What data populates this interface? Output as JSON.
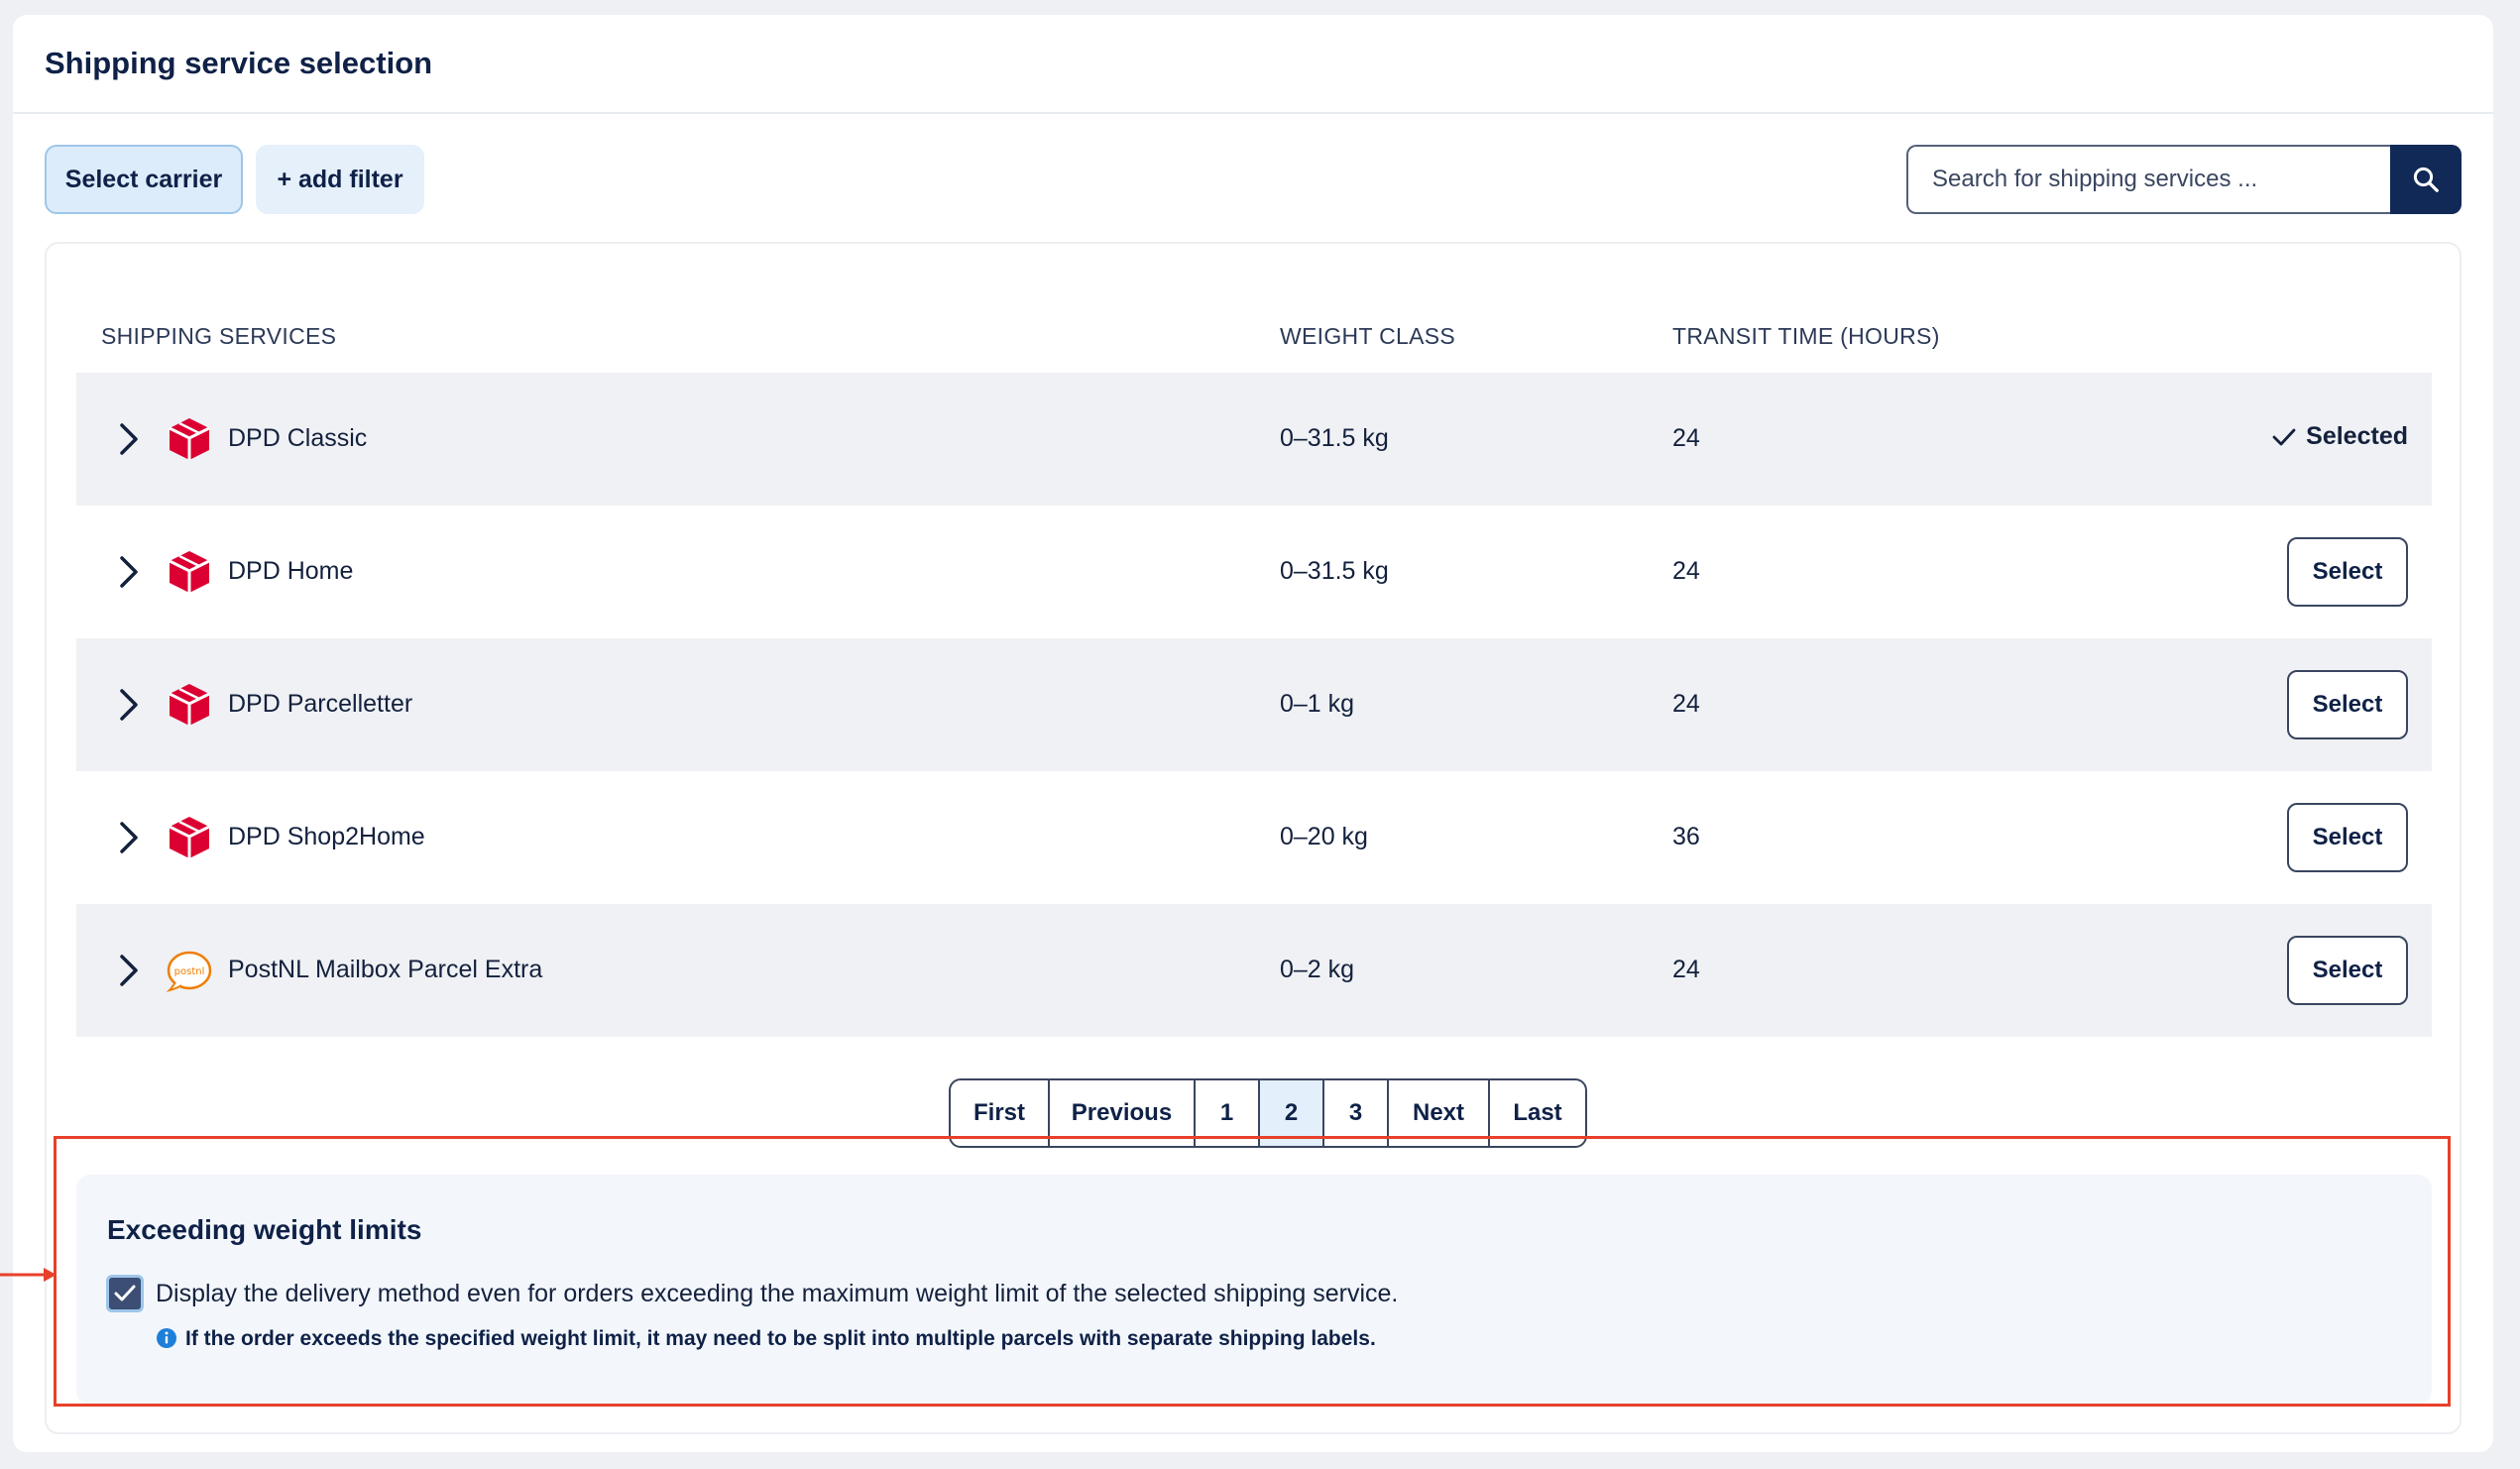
{
  "header": {
    "title": "Shipping service selection"
  },
  "toolbar": {
    "select_carrier_label": "Select carrier",
    "add_filter_label": "+ add filter",
    "search_placeholder": "Search for shipping services ..."
  },
  "table": {
    "columns": [
      "SHIPPING SERVICES",
      "WEIGHT CLASS",
      "TRANSIT TIME (HOURS)"
    ],
    "rows": [
      {
        "service": "DPD Classic",
        "carrier": "dpd-logo",
        "weight": "0–31.5 kg",
        "transit": "24",
        "status": "Selected"
      },
      {
        "service": "DPD Home",
        "carrier": "dpd-logo",
        "weight": "0–31.5 kg",
        "transit": "24",
        "action": "Select"
      },
      {
        "service": "DPD Parcelletter",
        "carrier": "dpd-logo",
        "weight": "0–1 kg",
        "transit": "24",
        "action": "Select"
      },
      {
        "service": "DPD Shop2Home",
        "carrier": "dpd-logo",
        "weight": "0–20 kg",
        "transit": "36",
        "action": "Select"
      },
      {
        "service": "PostNL Mailbox Parcel Extra",
        "carrier": "postnl-logo",
        "weight": "0–2 kg",
        "transit": "24",
        "action": "Select"
      }
    ]
  },
  "pagination": {
    "first": "First",
    "previous": "Previous",
    "pages": [
      "1",
      "2",
      "3"
    ],
    "current_page": "2",
    "next": "Next",
    "last": "Last"
  },
  "weight_limits": {
    "title": "Exceeding weight limits",
    "checkbox_label": "Display the delivery method even for orders exceeding the maximum weight limit of the selected shipping service.",
    "checkbox_checked": true,
    "info_text": "If the order exceeds the specified weight limit, it may need to be split into multiple parcels with separate shipping labels."
  },
  "logos": {
    "postnl_text": "postnl"
  },
  "colors": {
    "accent": "#112956",
    "dpd": "#dc0032",
    "postnl": "#f07d00",
    "highlight": "#e8402a",
    "info": "#1d7fd8"
  }
}
